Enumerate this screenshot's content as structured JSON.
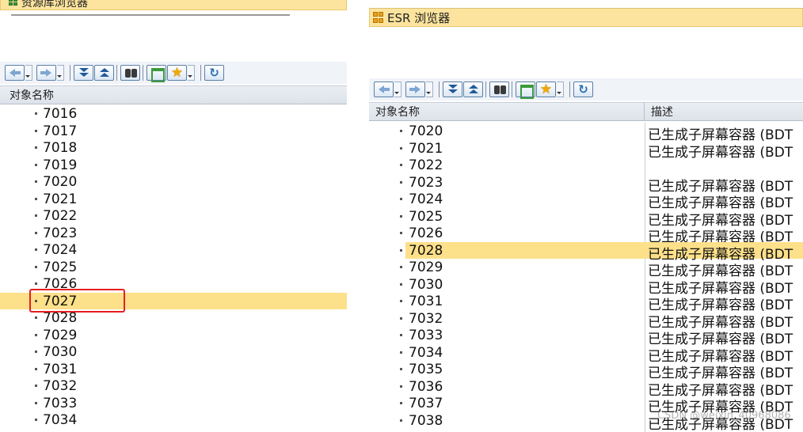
{
  "left_panel": {
    "title": "资源库浏览器",
    "column_header": "对象名称",
    "rows": [
      {
        "name": "7016"
      },
      {
        "name": "7017"
      },
      {
        "name": "7018"
      },
      {
        "name": "7019"
      },
      {
        "name": "7020"
      },
      {
        "name": "7021"
      },
      {
        "name": "7022"
      },
      {
        "name": "7023"
      },
      {
        "name": "7024"
      },
      {
        "name": "7025"
      },
      {
        "name": "7026"
      },
      {
        "name": "7027",
        "selected": true
      },
      {
        "name": "7028"
      },
      {
        "name": "7029"
      },
      {
        "name": "7030"
      },
      {
        "name": "7031"
      },
      {
        "name": "7032"
      },
      {
        "name": "7033"
      },
      {
        "name": "7034"
      }
    ],
    "highlighted_item": "7027"
  },
  "right_panel": {
    "title": "ESR 浏览器",
    "column_headers": {
      "name": "对象名称",
      "description": "描述"
    },
    "rows": [
      {
        "name": "7020",
        "desc": "已生成子屏幕容器 (BDT"
      },
      {
        "name": "7021",
        "desc": "已生成子屏幕容器 (BDT"
      },
      {
        "name": "7022",
        "desc": ""
      },
      {
        "name": "7023",
        "desc": "已生成子屏幕容器 (BDT"
      },
      {
        "name": "7024",
        "desc": "已生成子屏幕容器 (BDT"
      },
      {
        "name": "7025",
        "desc": "已生成子屏幕容器 (BDT"
      },
      {
        "name": "7026",
        "desc": "已生成子屏幕容器 (BDT"
      },
      {
        "name": "7028",
        "desc": "已生成子屏幕容器 (BDT",
        "selected": true
      },
      {
        "name": "7029",
        "desc": "已生成子屏幕容器 (BDT"
      },
      {
        "name": "7030",
        "desc": "已生成子屏幕容器 (BDT"
      },
      {
        "name": "7031",
        "desc": "已生成子屏幕容器 (BDT"
      },
      {
        "name": "7032",
        "desc": "已生成子屏幕容器 (BDT"
      },
      {
        "name": "7033",
        "desc": "已生成子屏幕容器 (BDT"
      },
      {
        "name": "7034",
        "desc": "已生成子屏幕容器 (BDT"
      },
      {
        "name": "7035",
        "desc": "已生成子屏幕容器 (BDT"
      },
      {
        "name": "7036",
        "desc": "已生成子屏幕容器 (BDT"
      },
      {
        "name": "7037",
        "desc": "已生成子屏幕容器 (BDT"
      },
      {
        "name": "7038",
        "desc": "已生成子屏幕容器 (BDT"
      }
    ]
  },
  "toolbar_icons": [
    "arrow-left-icon",
    "arrow-right-icon",
    "expand-all-icon",
    "collapse-all-icon",
    "binoculars-icon",
    "hierarchy-icon",
    "star-icon",
    "refresh-icon"
  ],
  "colors": {
    "selection": "#fde08a",
    "title_bar": "#fde49e",
    "highlight_box": "#e51f1f"
  },
  "watermark": "CSDN @weixin_40968086"
}
